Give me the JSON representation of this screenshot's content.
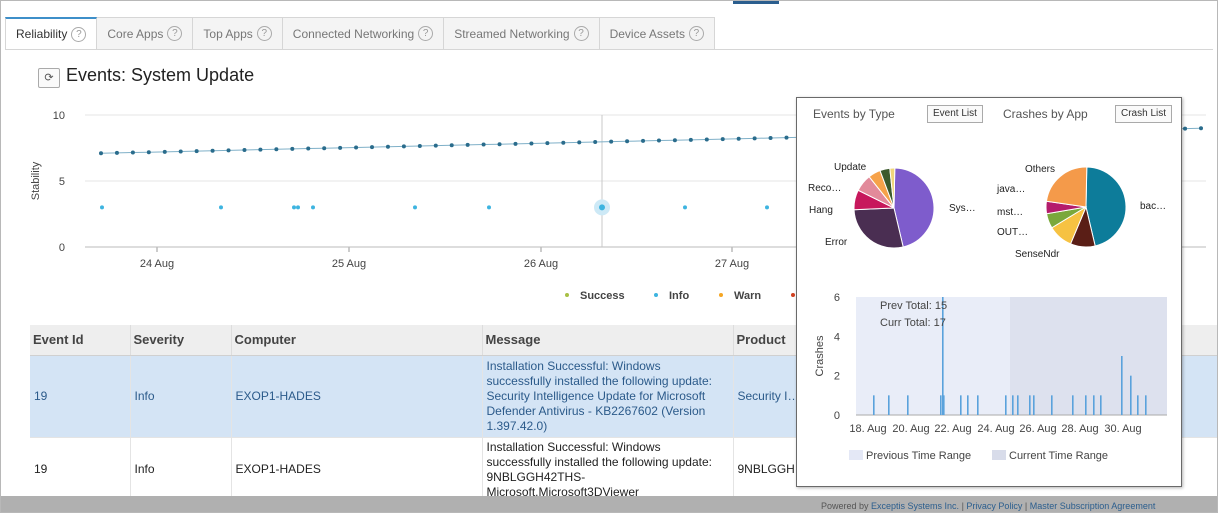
{
  "tabs": [
    {
      "label": "Reliability",
      "active": true
    },
    {
      "label": "Core Apps"
    },
    {
      "label": "Top Apps"
    },
    {
      "label": "Connected Networking"
    },
    {
      "label": "Streamed Networking"
    },
    {
      "label": "Device Assets"
    }
  ],
  "help_glyph": "?",
  "refresh_icon": "⟳",
  "title": "Events: System Update",
  "stability_chart": {
    "type": "scatter",
    "ylabel": "Stability",
    "y_ticks": [
      "10",
      "5",
      "0"
    ],
    "ylim": [
      0,
      10
    ],
    "x_ticks": [
      "24 Aug",
      "25 Aug",
      "26 Aug",
      "27 Aug"
    ],
    "stability_start": 7.1,
    "stability_end": 9.0,
    "info_points": [
      3,
      3,
      3,
      3,
      3,
      3,
      3,
      3,
      3,
      3
    ],
    "legend": [
      {
        "name": "Success",
        "color": "#a8c044"
      },
      {
        "name": "Info",
        "color": "#3db4e0"
      },
      {
        "name": "Warn",
        "color": "#f5a623"
      }
    ]
  },
  "table": {
    "headers": [
      "Event Id",
      "Severity",
      "Computer",
      "Message",
      "Product"
    ],
    "rows": [
      {
        "id": "19",
        "severity": "Info",
        "computer": "EXOP1-HADES",
        "message": "Installation Successful: Windows successfully installed the following update: Security Intelligence Update for Microsoft Defender Antivirus - KB2267602 (Version 1.397.42.0)",
        "product": "Security I… Microsoft … KB22676…"
      },
      {
        "id": "19",
        "severity": "Info",
        "computer": "EXOP1-HADES",
        "message": "Installation Successful: Windows successfully installed the following update: 9NBLGGH42THS-Microsoft.Microsoft3DViewer",
        "product": "9NBLGGH… Microsoft…"
      }
    ]
  },
  "footer": {
    "prefix": "Powered by ",
    "company": "Exceptis Systems Inc.",
    "sep": " | ",
    "privacy": "Privacy Policy",
    "agreement": "Master Subscription Agreement"
  },
  "popup": {
    "events_title": "Events by Type",
    "event_list_btn": "Event List",
    "crashes_title": "Crashes by App",
    "crash_list_btn": "Crash List",
    "events_by_type": [
      {
        "label": "Sys…",
        "value": 46,
        "color": "#7e5ccc"
      },
      {
        "label": "Error",
        "value": 28,
        "color": "#4a2e52"
      },
      {
        "label": "Hang",
        "value": 8,
        "color": "#c7185c"
      },
      {
        "label": "Reco…",
        "value": 7,
        "color": "#e28a9a"
      },
      {
        "label": "",
        "value": 5,
        "color": "#f6a24a"
      },
      {
        "label": "Update",
        "value": 4,
        "color": "#3c5a2c"
      },
      {
        "label": "",
        "value": 2,
        "color": "#f0d67a"
      }
    ],
    "crashes_by_app": [
      {
        "label": "bac…",
        "value": 46,
        "color": "#0d7c9a"
      },
      {
        "label": "SenseNdr",
        "value": 10,
        "color": "#5a1e16"
      },
      {
        "label": "OUT…",
        "value": 10,
        "color": "#f6c242"
      },
      {
        "label": "mst…",
        "value": 6,
        "color": "#7aa83c"
      },
      {
        "label": "java…",
        "value": 5,
        "color": "#b41c6c"
      },
      {
        "label": "Others",
        "value": 23,
        "color": "#f49a4a"
      }
    ],
    "crash_chart": {
      "type": "bar",
      "ylabel": "Crashes",
      "y_ticks": [
        "6",
        "4",
        "2",
        "0"
      ],
      "ylim": [
        0,
        6
      ],
      "x_ticks": [
        "18. Aug",
        "20. Aug",
        "22. Aug",
        "24. Aug",
        "26. Aug",
        "28. Aug",
        "30. Aug"
      ],
      "prev_total": "Prev Total: 15",
      "curr_total": "Curr Total: 17",
      "bars": [
        1,
        1,
        1,
        1,
        1,
        6,
        1,
        1,
        1,
        1,
        1,
        1,
        1,
        1,
        1,
        1,
        1,
        1,
        1,
        3,
        2,
        1,
        1
      ],
      "legend": [
        {
          "name": "Previous Time Range",
          "color": "#e4e8f6"
        },
        {
          "name": "Current Time Range",
          "color": "#d8dcea"
        }
      ]
    }
  }
}
